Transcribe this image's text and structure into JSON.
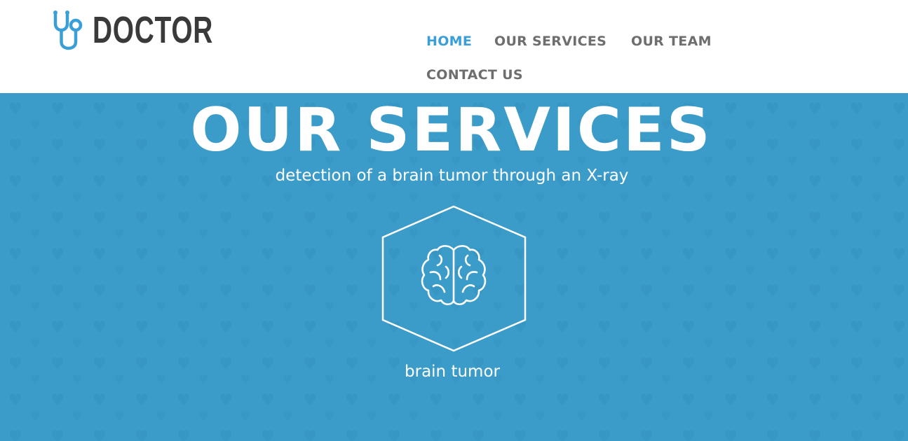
{
  "brand": {
    "logo_text": "DOCTOR",
    "icon": "stethoscope-icon",
    "accent_color": "#3a9fd6",
    "text_color": "#3a3a3a"
  },
  "nav": {
    "items": [
      {
        "label": "HOME",
        "active": true
      },
      {
        "label": "OUR SERVICES",
        "active": false
      },
      {
        "label": "OUR TEAM",
        "active": false
      },
      {
        "label": "CONTACT US",
        "active": false
      }
    ],
    "active_color": "#3a9fd6",
    "color": "#6e6e6e"
  },
  "hero": {
    "title": "OUR SERVICES",
    "subtitle": "detection of a brain tumor through an X-ray",
    "background_color": "#3b9cc9",
    "services": [
      {
        "label": "brain tumor",
        "icon": "brain-icon"
      }
    ]
  }
}
